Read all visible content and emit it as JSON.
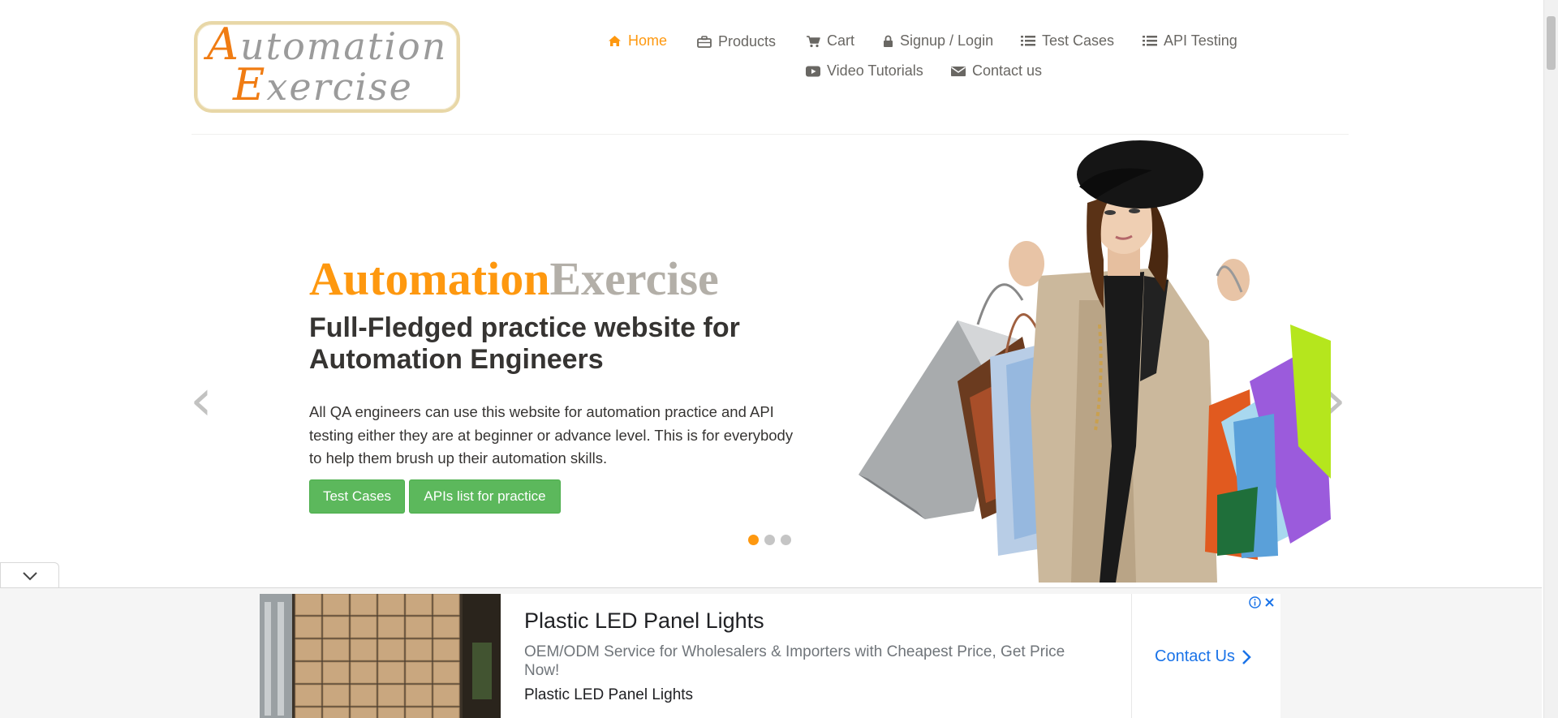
{
  "logo": {
    "line1_cap": "A",
    "line1_rest": "utomation",
    "line2_cap": "E",
    "line2_rest": "xercise"
  },
  "nav": {
    "home": "Home",
    "products": "Products",
    "cart": "Cart",
    "signup_login": "Signup / Login",
    "test_cases": "Test Cases",
    "api_testing": "API Testing",
    "video_tutorials": "Video Tutorials",
    "contact_us": "Contact us",
    "icons": [
      "home-icon",
      "briefcase-icon",
      "cart-icon",
      "lock-icon",
      "list-icon",
      "list-icon",
      "youtube-icon",
      "envelope-icon"
    ]
  },
  "slider": {
    "brand_a": "Automation",
    "brand_b": "Exercise",
    "heading": "Full-Fledged practice website for Automation Engineers",
    "description": "All QA engineers can use this website for automation practice and API testing either they are at beginner or advance level. This is for everybody to help them brush up their automation skills.",
    "btn_test_cases": "Test Cases",
    "btn_apis": "APIs list for practice",
    "prev": "‹",
    "next": "›",
    "active_slide": 1,
    "slide_count": 3
  },
  "ad": {
    "title": "Plastic LED Panel Lights",
    "description": "OEM/ODM Service for Wholesalers & Importers with Cheapest Price, Get Price Now!",
    "source": "Plastic LED Panel Lights",
    "cta": "Contact Us"
  },
  "colors": {
    "accent": "#fe980f",
    "button_green": "#5cb85c",
    "text_dark": "#363432",
    "nav_text": "#696763",
    "link_blue": "#1a73e8"
  }
}
